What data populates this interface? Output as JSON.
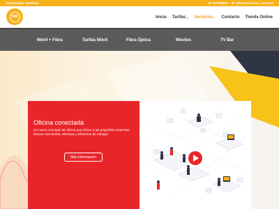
{
  "topbar": {
    "distributor": "Distribuidor Vodafone",
    "phone": "937006500",
    "email": "info@sinred.es",
    "separator": "|",
    "intranet": "Intranet",
    "background_color": "#f7b11a"
  },
  "header": {
    "logo_text": "red",
    "nav": [
      {
        "label": "Inicio",
        "dropdown": false
      },
      {
        "label": "Tarifas",
        "dropdown": true
      },
      {
        "label": "Servicios",
        "dropdown": true
      },
      {
        "label": "Contacto",
        "dropdown": false
      },
      {
        "label": "Tienda Online",
        "dropdown": false
      }
    ],
    "dropdown_icon": "chevron-down-icon",
    "accent_color": "#f39a1a"
  },
  "menubar": {
    "items": [
      "Móvil + Fibra",
      "Tarifas Móvil",
      "Fibra Óptica",
      "Móviles",
      "TV Bar"
    ],
    "background_color": "#5b5b5b"
  },
  "hero": {
    "title": "Oficina conectada",
    "description": "Un nuevo concepto de oficina que ofrece a las pequeñas empresas formas más fáciles, efectivas y eficientes de trabajar.",
    "button_label": "Más información",
    "card_color": "#e8262a",
    "illustration": "office-network-illustration",
    "play_icon": "play-icon"
  }
}
